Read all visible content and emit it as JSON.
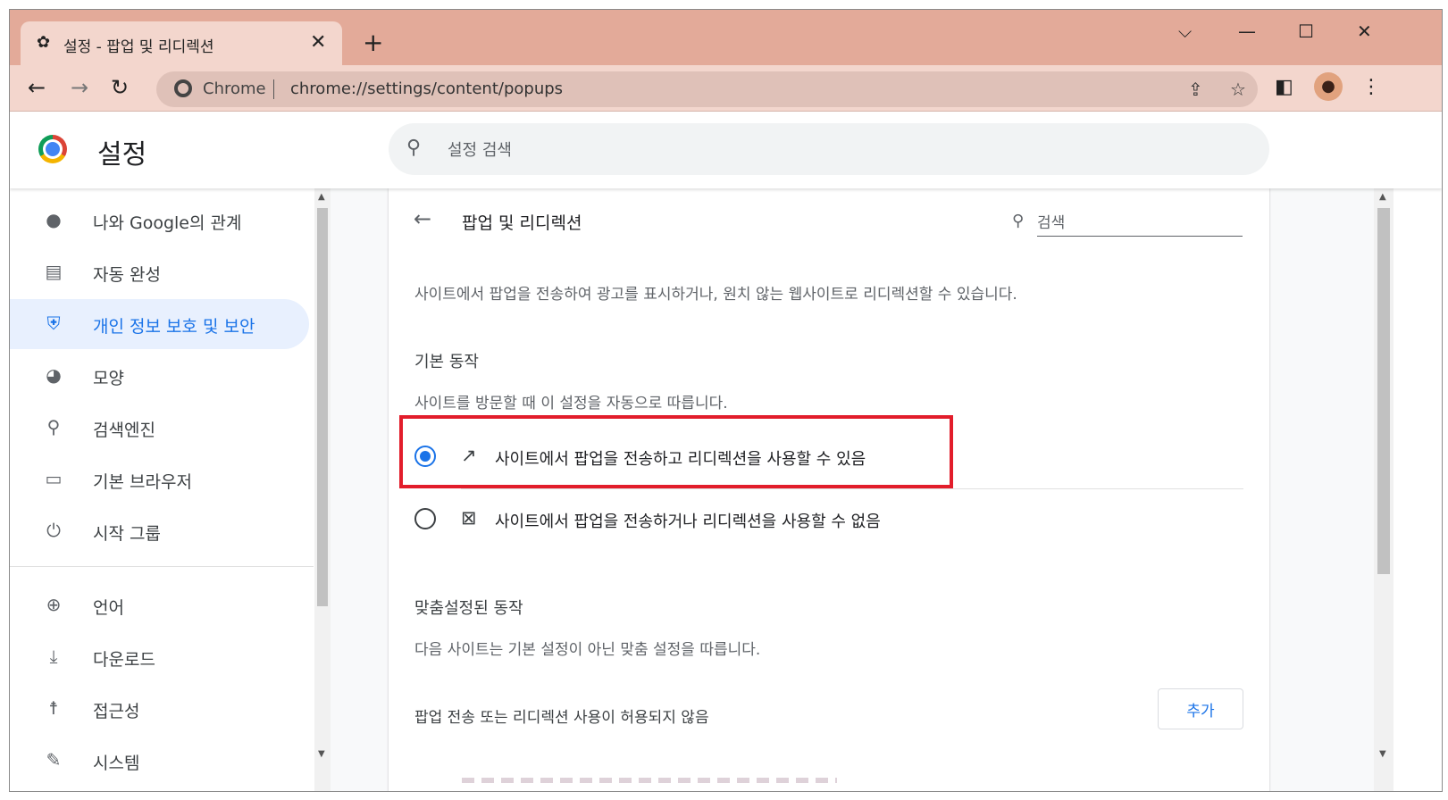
{
  "browser": {
    "tab_title": "설정 - 팝업 및 리디렉션",
    "chip_label": "Chrome",
    "url": "chrome://settings/content/popups"
  },
  "settings": {
    "header_title": "설정",
    "search_placeholder": "설정 검색"
  },
  "sidebar": {
    "items": [
      {
        "label": "나와 Google의 관계",
        "icon": "person-icon"
      },
      {
        "label": "자동 완성",
        "icon": "clipboard-icon"
      },
      {
        "label": "개인 정보 보호 및 보안",
        "icon": "shield-icon",
        "active": true
      },
      {
        "label": "모양",
        "icon": "palette-icon"
      },
      {
        "label": "검색엔진",
        "icon": "search-icon"
      },
      {
        "label": "기본 브라우저",
        "icon": "browser-icon"
      },
      {
        "label": "시작 그룹",
        "icon": "power-icon"
      },
      {
        "label": "언어",
        "icon": "globe-icon"
      },
      {
        "label": "다운로드",
        "icon": "download-icon"
      },
      {
        "label": "접근성",
        "icon": "accessibility-icon"
      },
      {
        "label": "시스템",
        "icon": "wrench-icon"
      }
    ]
  },
  "content": {
    "page_title": "팝업 및 리디렉션",
    "search_label": "검색",
    "description": "사이트에서 팝업을 전송하여 광고를 표시하거나, 원치 않는 웹사이트로 리디렉션할 수 있습니다.",
    "default_section_title": "기본 동작",
    "default_section_desc": "사이트를 방문할 때 이 설정을 자동으로 따릅니다.",
    "options": [
      {
        "label": "사이트에서 팝업을 전송하고 리디렉션을 사용할 수 있음",
        "checked": true,
        "icon": "open-in-new-icon"
      },
      {
        "label": "사이트에서 팝업을 전송하거나 리디렉션을 사용할 수 없음",
        "checked": false,
        "icon": "popup-blocked-icon"
      }
    ],
    "custom_section_title": "맞춤설정된 동작",
    "custom_section_desc": "다음 사이트는 기본 설정이 아닌 맞춤 설정을 따릅니다.",
    "blocked_label": "팝업 전송 또는 리디렉션 사용이 허용되지 않음",
    "add_button": "추가"
  },
  "colors": {
    "titlebar": "#e3aa99",
    "accent": "#1a73e8",
    "highlight": "#e21d2b"
  }
}
